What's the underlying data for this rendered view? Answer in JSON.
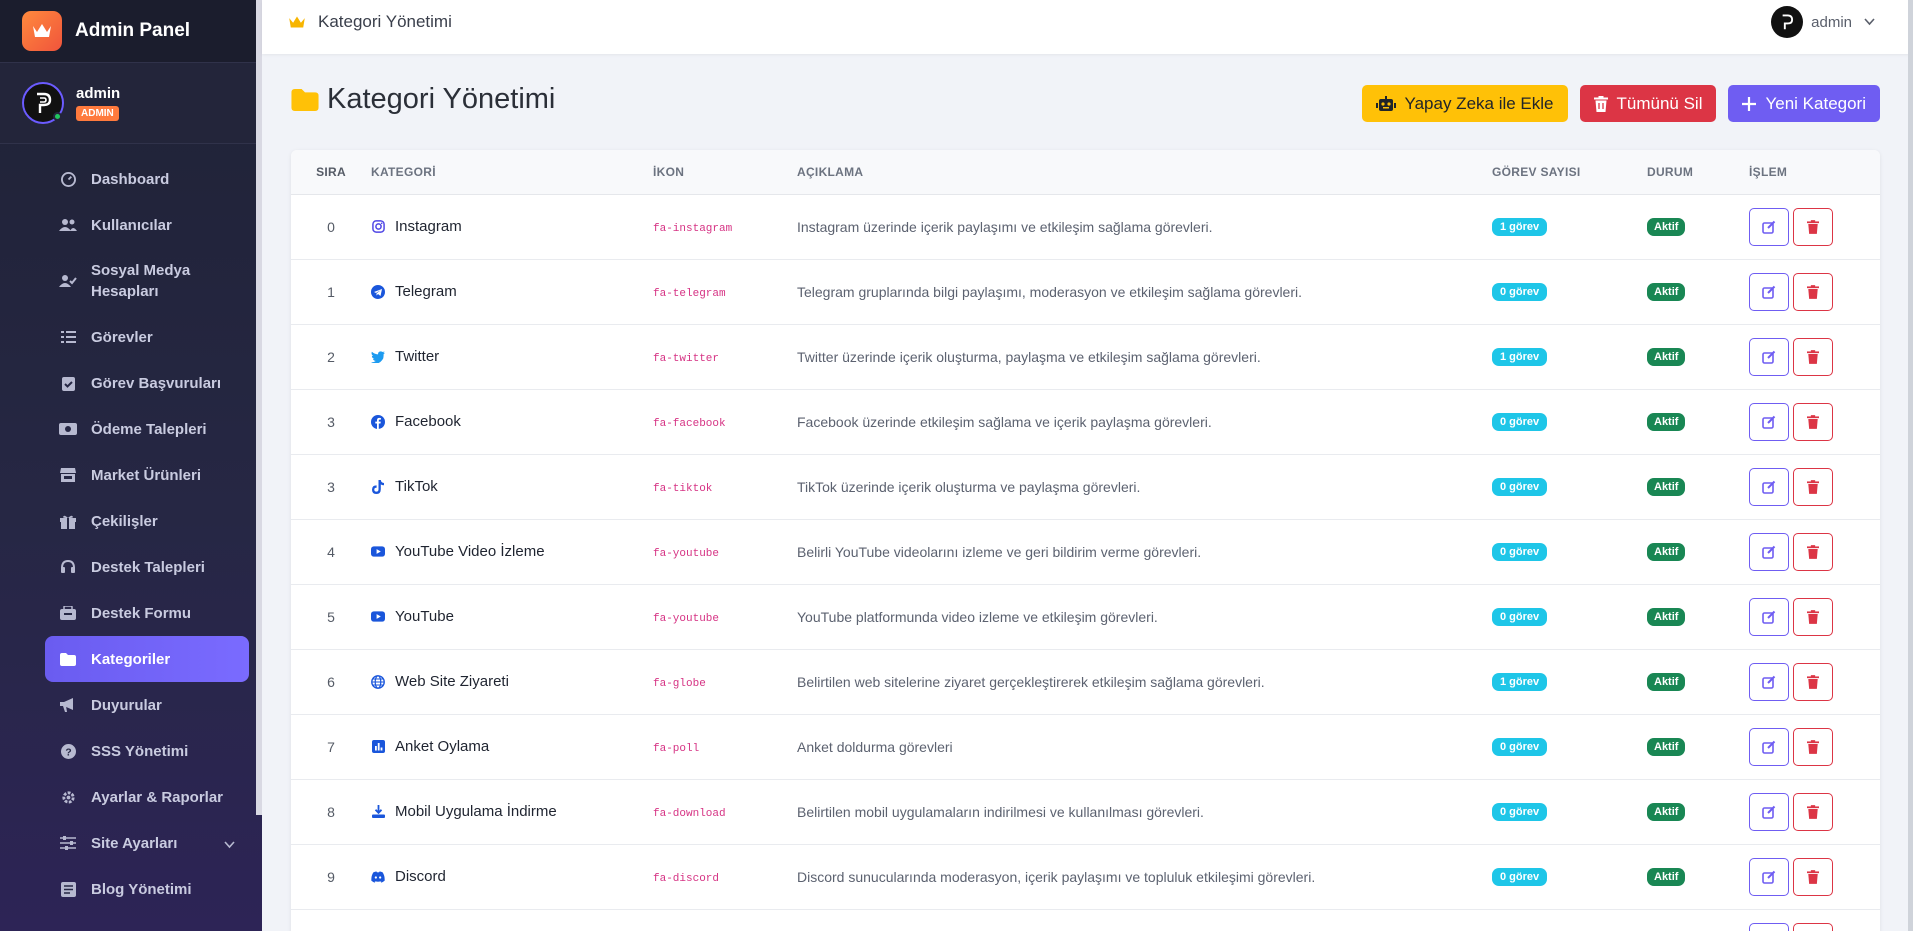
{
  "brand": {
    "title": "Admin Panel"
  },
  "user": {
    "name": "admin",
    "role": "ADMIN"
  },
  "sidebar": {
    "items": [
      {
        "label": "Dashboard",
        "icon": "dashboard-icon"
      },
      {
        "label": "Kullanıcılar",
        "icon": "users-icon"
      },
      {
        "label": "Sosyal Medya Hesapları",
        "icon": "user-check-icon"
      },
      {
        "label": "Görevler",
        "icon": "tasks-icon"
      },
      {
        "label": "Görev Başvuruları",
        "icon": "clipboard-check-icon"
      },
      {
        "label": "Ödeme Talepleri",
        "icon": "money-icon"
      },
      {
        "label": "Market Ürünleri",
        "icon": "store-icon"
      },
      {
        "label": "Çekilişler",
        "icon": "gift-icon"
      },
      {
        "label": "Destek Talepleri",
        "icon": "headset-icon"
      },
      {
        "label": "Destek Formu",
        "icon": "form-icon"
      },
      {
        "label": "Kategoriler",
        "icon": "folder-icon",
        "active": true
      },
      {
        "label": "Duyurular",
        "icon": "megaphone-icon"
      },
      {
        "label": "SSS Yönetimi",
        "icon": "question-icon"
      },
      {
        "label": "Ayarlar & Raporlar",
        "icon": "gear-icon"
      },
      {
        "label": "Site Ayarları",
        "icon": "sliders-icon"
      },
      {
        "label": "Blog Yönetimi",
        "icon": "blog-icon"
      }
    ]
  },
  "topbar": {
    "title": "Kategori Yönetimi",
    "user": "admin"
  },
  "page": {
    "title": "Kategori Yönetimi",
    "actions": {
      "ai_add": "Yapay Zeka ile Ekle",
      "delete_all": "Tümünü Sil",
      "new": "Yeni Kategori"
    }
  },
  "table": {
    "headers": {
      "sira": "SIRA",
      "kategori": "KATEGORİ",
      "ikon": "İKON",
      "aciklama": "AÇIKLAMA",
      "gorev": "GÖREV SAYISI",
      "durum": "DURUM",
      "islem": "İŞLEM"
    },
    "rows": [
      {
        "sira": "0",
        "name": "Instagram",
        "icon": "fa-instagram",
        "desc": "Instagram üzerinde içerik paylaşımı ve etkileşim sağlama görevleri.",
        "gorev": "1 görev",
        "durum": "Aktif"
      },
      {
        "sira": "1",
        "name": "Telegram",
        "icon": "fa-telegram",
        "desc": "Telegram gruplarında bilgi paylaşımı, moderasyon ve etkileşim sağlama görevleri.",
        "gorev": "0 görev",
        "durum": "Aktif"
      },
      {
        "sira": "2",
        "name": "Twitter",
        "icon": "fa-twitter",
        "desc": "Twitter üzerinde içerik oluşturma, paylaşma ve etkileşim sağlama görevleri.",
        "gorev": "1 görev",
        "durum": "Aktif"
      },
      {
        "sira": "3",
        "name": "Facebook",
        "icon": "fa-facebook",
        "desc": "Facebook üzerinde etkileşim sağlama ve içerik paylaşma görevleri.",
        "gorev": "0 görev",
        "durum": "Aktif"
      },
      {
        "sira": "3",
        "name": "TikTok",
        "icon": "fa-tiktok",
        "desc": "TikTok üzerinde içerik oluşturma ve paylaşma görevleri.",
        "gorev": "0 görev",
        "durum": "Aktif"
      },
      {
        "sira": "4",
        "name": "YouTube Video İzleme",
        "icon": "fa-youtube",
        "desc": "Belirli YouTube videolarını izleme ve geri bildirim verme görevleri.",
        "gorev": "0 görev",
        "durum": "Aktif"
      },
      {
        "sira": "5",
        "name": "YouTube",
        "icon": "fa-youtube",
        "desc": "YouTube platformunda video izleme ve etkileşim görevleri.",
        "gorev": "0 görev",
        "durum": "Aktif"
      },
      {
        "sira": "6",
        "name": "Web Site Ziyareti",
        "icon": "fa-globe",
        "desc": "Belirtilen web sitelerine ziyaret gerçekleştirerek etkileşim sağlama görevleri.",
        "gorev": "1 görev",
        "durum": "Aktif"
      },
      {
        "sira": "7",
        "name": "Anket Oylama",
        "icon": "fa-poll",
        "desc": "Anket doldurma görevleri",
        "gorev": "0 görev",
        "durum": "Aktif"
      },
      {
        "sira": "8",
        "name": "Mobil Uygulama İndirme",
        "icon": "fa-download",
        "desc": "Belirtilen mobil uygulamaların indirilmesi ve kullanılması görevleri.",
        "gorev": "0 görev",
        "durum": "Aktif"
      },
      {
        "sira": "9",
        "name": "Discord",
        "icon": "fa-discord",
        "desc": "Discord sunucularında moderasyon, içerik paylaşımı ve topluluk etkileşimi görevleri.",
        "gorev": "0 görev",
        "durum": "Aktif"
      }
    ]
  },
  "colors": {
    "accent": "#6f5df2",
    "danger": "#dc3545",
    "warning": "#ffc107",
    "info": "#1ec6e8",
    "success": "#198754",
    "sidebar": "#262744"
  }
}
